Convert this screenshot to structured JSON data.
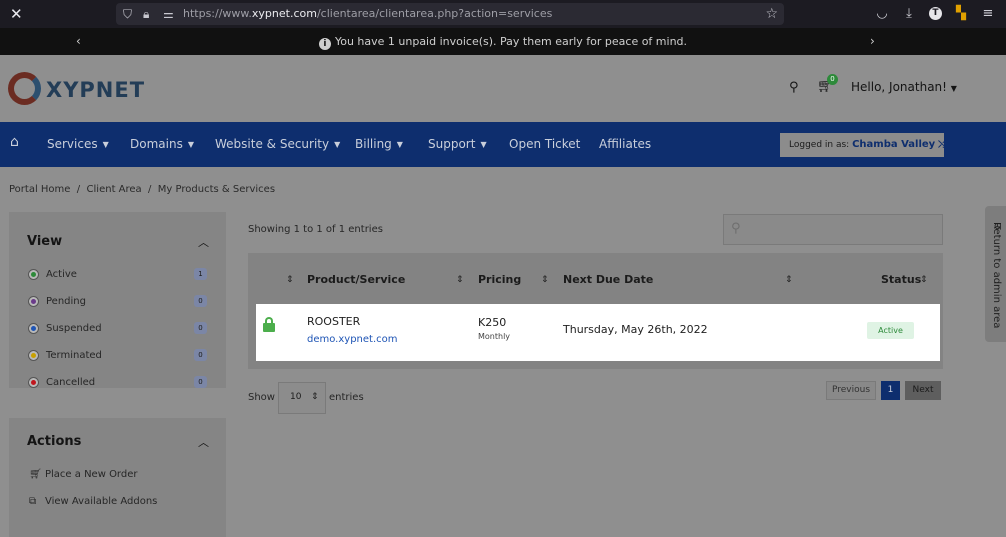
{
  "browser": {
    "url_prefix": "https://www.",
    "url_domain": "xypnet.com",
    "url_path": "/clientarea/clientarea.php?action=services",
    "profile_initial": "T"
  },
  "notice": {
    "message": "You have 1 unpaid invoice(s). Pay them early for peace of mind."
  },
  "header": {
    "logo_text": "XYPNET",
    "cart_count": "0",
    "greeting": "Hello, Jonathan!"
  },
  "nav": {
    "items": [
      {
        "label": "Services"
      },
      {
        "label": "Domains"
      },
      {
        "label": "Website & Security"
      },
      {
        "label": "Billing"
      },
      {
        "label": "Support"
      },
      {
        "label": "Open Ticket"
      },
      {
        "label": "Affiliates"
      }
    ],
    "logged_in_prefix": "Logged in as:",
    "logged_in_name": "Chamba Valley"
  },
  "breadcrumb": {
    "items": [
      "Portal Home",
      "Client Area",
      "My Products & Services"
    ]
  },
  "sidebar": {
    "view_title": "View",
    "filters": [
      {
        "label": "Active",
        "count": "1",
        "color": "#2d8a3a"
      },
      {
        "label": "Pending",
        "count": "0",
        "color": "#6a3a8a"
      },
      {
        "label": "Suspended",
        "count": "0",
        "color": "#1f55b5"
      },
      {
        "label": "Terminated",
        "count": "0",
        "color": "#c8a000"
      },
      {
        "label": "Cancelled",
        "count": "0",
        "color": "#c0161e"
      }
    ],
    "actions_title": "Actions",
    "actions": [
      {
        "label": "Place a New Order",
        "icon": "cart-icon"
      },
      {
        "label": "View Available Addons",
        "icon": "cubes-icon"
      }
    ]
  },
  "table": {
    "showing_text": "Showing 1 to 1 of 1 entries",
    "headers": [
      "Product/Service",
      "Pricing",
      "Next Due Date",
      "Status"
    ],
    "rows": [
      {
        "product": "ROOSTER",
        "domain": "demo.xypnet.com",
        "price": "K250",
        "cycle": "Monthly",
        "next_due": "Thursday, May 26th, 2022",
        "status": "Active"
      }
    ],
    "show_label": "Show",
    "entries_value": "10",
    "entries_label": "entries",
    "pagination": {
      "previous": "Previous",
      "current": "1",
      "next": "Next"
    }
  },
  "admin": {
    "return_label": "Return to admin area"
  }
}
